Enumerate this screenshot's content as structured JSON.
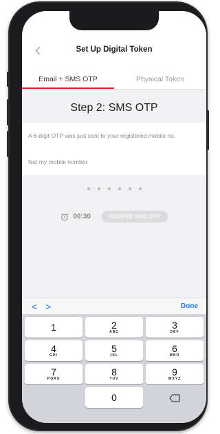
{
  "header": {
    "title": "Set Up Digital Token",
    "back_icon": "chevron-left-icon"
  },
  "tabs": [
    {
      "label": "Email + SMS OTP",
      "active": true
    },
    {
      "label": "Physical Token",
      "active": false
    }
  ],
  "main": {
    "step_title": "Step 2: SMS OTP",
    "info_text": "A 6-digit OTP was just sent to your registered mobile no.",
    "change_number_link": "Not my mobile number",
    "otp_digits_entered": 0,
    "otp_length": 6,
    "timer": "00:30",
    "timer_icon": "alarm-clock-icon",
    "resend_label": "RESEND SMS OTP"
  },
  "keyboard": {
    "prev_symbol": "<",
    "next_symbol": ">",
    "done_label": "Done",
    "keys": [
      [
        {
          "num": "1",
          "letters": ""
        },
        {
          "num": "2",
          "letters": "ABC"
        },
        {
          "num": "3",
          "letters": "DEF"
        }
      ],
      [
        {
          "num": "4",
          "letters": "GHI"
        },
        {
          "num": "5",
          "letters": "JKL"
        },
        {
          "num": "6",
          "letters": "MNO"
        }
      ],
      [
        {
          "num": "7",
          "letters": "PQRS"
        },
        {
          "num": "8",
          "letters": "TUV"
        },
        {
          "num": "9",
          "letters": "WXYZ"
        }
      ],
      [
        {
          "num": "0",
          "letters": ""
        }
      ]
    ],
    "delete_icon": "backspace-icon"
  },
  "colors": {
    "accent": "#d9261c",
    "link": "#2a7ae2",
    "keypad_bg": "#d2d4d9"
  }
}
